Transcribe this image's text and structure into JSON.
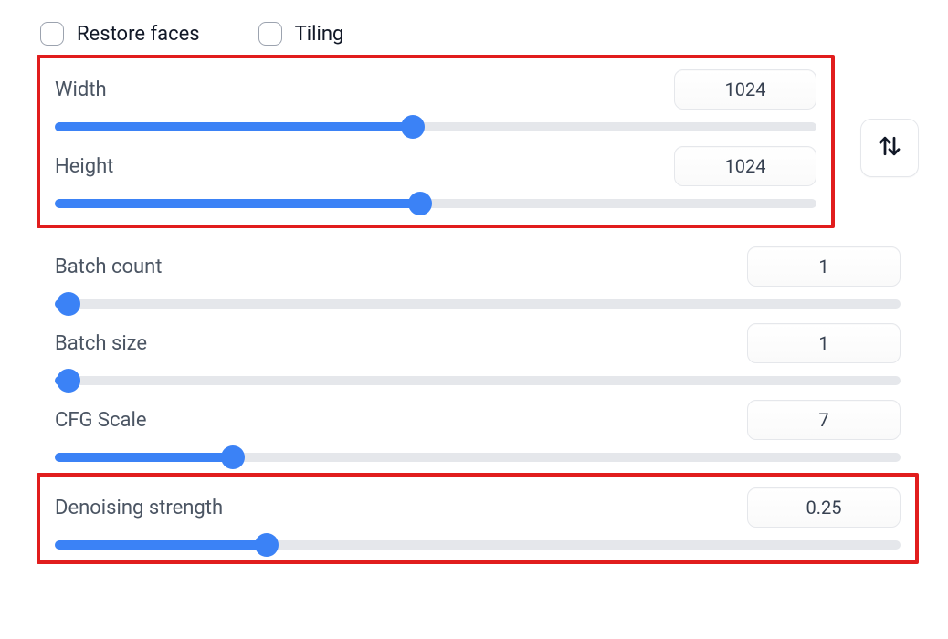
{
  "checks": {
    "restore_faces_label": "Restore faces",
    "tiling_label": "Tiling"
  },
  "sliders": {
    "width": {
      "label": "Width",
      "value": "1024",
      "fill_pct": 47
    },
    "height": {
      "label": "Height",
      "value": "1024",
      "fill_pct": 48
    },
    "batch_count": {
      "label": "Batch count",
      "value": "1",
      "fill_pct": 1.5
    },
    "batch_size": {
      "label": "Batch size",
      "value": "1",
      "fill_pct": 1.5
    },
    "cfg_scale": {
      "label": "CFG Scale",
      "value": "7",
      "fill_pct": 21
    },
    "denoise": {
      "label": "Denoising strength",
      "value": "0.25",
      "fill_pct": 25
    }
  },
  "icons": {
    "swap": "swap-vertical-icon"
  }
}
